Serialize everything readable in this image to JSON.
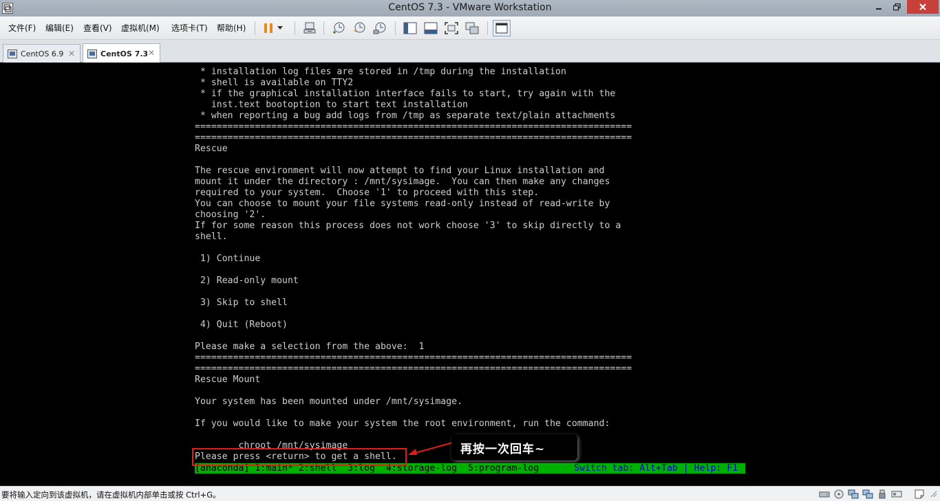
{
  "window": {
    "title": "CentOS 7.3 - VMware Workstation",
    "controls": [
      "minimize-icon",
      "restore-icon",
      "close-icon"
    ]
  },
  "menu": [
    "文件(F)",
    "编辑(E)",
    "查看(V)",
    "虚拟机(M)",
    "选项卡(T)",
    "帮助(H)"
  ],
  "toolbar_icons": [
    "pause-icon",
    "dropdown-icon",
    "send-ctrl-alt-del-icon",
    "snapshot-icon",
    "revert-snapshot-icon",
    "snapshot-manager-icon",
    "sidebar-icon",
    "thumbnail-bar-icon",
    "fullscreen-icon",
    "unity-icon",
    "console-view-icon"
  ],
  "tabs": [
    {
      "label": "CentOS 6.9",
      "active": false
    },
    {
      "label": "CentOS 7.3",
      "active": true
    }
  ],
  "console": {
    "lines": [
      " * installation log files are stored in /tmp during the installation",
      " * shell is available on TTY2",
      " * if the graphical installation interface fails to start, try again with the",
      "   inst.text bootoption to start text installation",
      " * when reporting a bug add logs from /tmp as separate text/plain attachments",
      "================================================================================",
      "================================================================================",
      "Rescue",
      "",
      "The rescue environment will now attempt to find your Linux installation and",
      "mount it under the directory : /mnt/sysimage.  You can then make any changes",
      "required to your system.  Choose '1' to proceed with this step.",
      "You can choose to mount your file systems read-only instead of read-write by",
      "choosing '2'.",
      "If for some reason this process does not work choose '3' to skip directly to a",
      "shell.",
      "",
      " 1) Continue",
      "",
      " 2) Read-only mount",
      "",
      " 3) Skip to shell",
      "",
      " 4) Quit (Reboot)",
      "",
      "Please make a selection from the above:  1",
      "================================================================================",
      "================================================================================",
      "Rescue Mount",
      "",
      "Your system has been mounted under /mnt/sysimage.",
      "",
      "If you would like to make your system the root environment, run the command:",
      "",
      "        chroot /mnt/sysimage",
      "Please press <return> to get a shell."
    ],
    "tmux_left": "[anaconda] 1:main* 2:shell  3:log  4:storage-log  5:program-log",
    "tmux_right": "Switch tab: Alt+Tab | Help: F1"
  },
  "annotation": {
    "callout_text": "再按一次回车~",
    "color": "#e01c1c"
  },
  "statusbar": {
    "message": "要将输入定向到该虚拟机，请在虚拟机内部单击或按 Ctrl+G。",
    "device_icons": [
      "hard-disk-icon",
      "cd-dvd-icon",
      "network-adapter-icon",
      "network-adapter-2-icon",
      "usb-icon",
      "sound-card-icon",
      "display-icon",
      "message-log-icon"
    ]
  }
}
